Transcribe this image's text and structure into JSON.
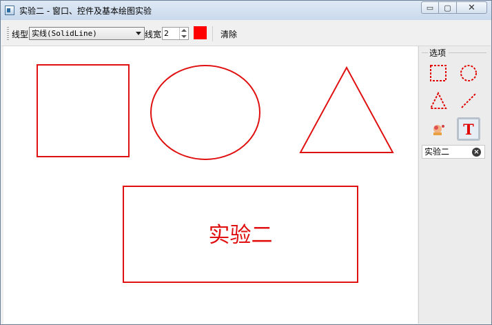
{
  "window": {
    "title": "实验二 - 窗口、控件及基本绘图实验",
    "buttons": {
      "minimize": "▭",
      "maximize": "▢",
      "close": "✕"
    }
  },
  "toolbar": {
    "line_style_label": "线型",
    "line_style_value": "实线(SolidLine)",
    "line_width_label": "线宽",
    "line_width_value": "2",
    "color": "#ff0000",
    "clear_label": "清除"
  },
  "canvas": {
    "stroke_color": "#e01010",
    "shapes": [
      "rectangle",
      "ellipse",
      "triangle",
      "text-rectangle"
    ],
    "text": "实验二"
  },
  "panel": {
    "title": "选项",
    "tools": [
      {
        "name": "rectangle-tool",
        "icon": "dashed-rectangle-icon"
      },
      {
        "name": "ellipse-tool",
        "icon": "dashed-circle-icon"
      },
      {
        "name": "triangle-tool",
        "icon": "dashed-triangle-icon"
      },
      {
        "name": "line-tool",
        "icon": "dashed-line-icon"
      },
      {
        "name": "image-tool",
        "icon": "image-icon"
      },
      {
        "name": "text-tool",
        "icon": "text-t-icon",
        "letter": "T",
        "active": true
      }
    ],
    "text_input_value": "实验二",
    "clear_icon": "×"
  }
}
